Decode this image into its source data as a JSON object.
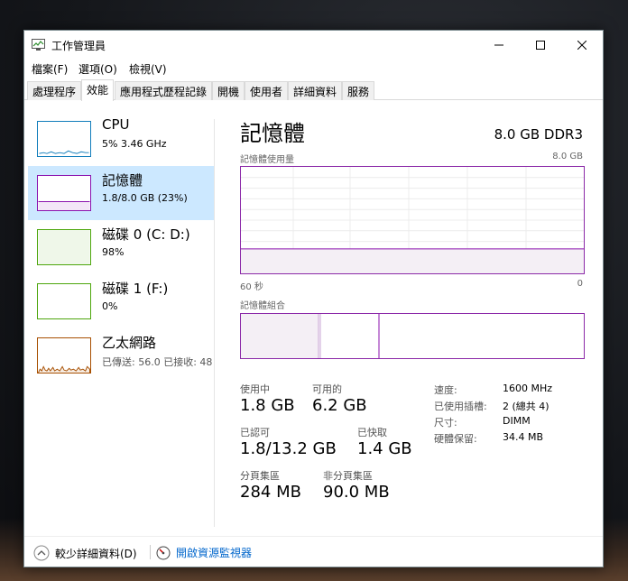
{
  "window": {
    "title": "工作管理員"
  },
  "menu": [
    "檔案(F)",
    "選項(O)",
    "檢視(V)"
  ],
  "tabs": [
    "處理程序",
    "效能",
    "應用程式歷程記錄",
    "開機",
    "使用者",
    "詳細資料",
    "服務"
  ],
  "active_tab": "效能",
  "sidebar": [
    {
      "name": "CPU",
      "value": "5%  3.46 GHz",
      "color": "#117dbb"
    },
    {
      "name": "記憶體",
      "value": "1.8/8.0 GB (23%)",
      "color": "#8b12ae"
    },
    {
      "name": "磁碟 0 (C: D:)",
      "value": "98%",
      "color": "#4da60c"
    },
    {
      "name": "磁碟 1 (F:)",
      "value": "0%",
      "color": "#4da60c"
    },
    {
      "name": "乙太網路",
      "value": "已傳送: 56.0  已接收: 48",
      "color": "#a74f01"
    }
  ],
  "main": {
    "title": "記憶體",
    "spec": "8.0 GB DDR3",
    "usage_label": "記憶體使用量",
    "usage_max": "8.0 GB",
    "time_left": "60 秒",
    "time_right": "0",
    "composition_label": "記憶體組合",
    "in_use_fraction": 0.23
  },
  "stats": {
    "in_use_label": "使用中",
    "in_use": "1.8 GB",
    "available_label": "可用的",
    "available": "6.2 GB",
    "committed_label": "已認可",
    "committed": "1.8/13.2 GB",
    "cached_label": "已快取",
    "cached": "1.4 GB",
    "paged_label": "分頁集區",
    "paged": "284 MB",
    "nonpaged_label": "非分頁集區",
    "nonpaged": "90.0 MB"
  },
  "right_stats": [
    {
      "label": "速度:",
      "value": "1600 MHz"
    },
    {
      "label": "已使用插槽:",
      "value": "2 (總共 4)"
    },
    {
      "label": "尺寸:",
      "value": "DIMM"
    },
    {
      "label": "硬體保留:",
      "value": "34.4 MB"
    }
  ],
  "footer": {
    "fewer_details": "較少詳細資料(D)",
    "resource_monitor": "開啟資源監視器"
  },
  "colors": {
    "accent": "#8b12ae",
    "selection": "#cce8ff",
    "link": "#0066cc"
  }
}
